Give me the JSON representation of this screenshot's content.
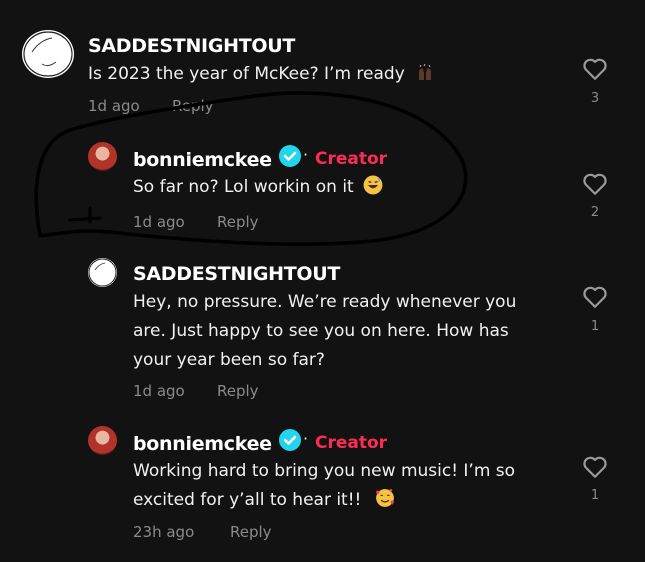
{
  "comments": [
    {
      "username": "SADDESTNIGHTOUT",
      "text": "Is 2023 the year of McKee? I’m ready",
      "emoji": "raised-hands",
      "time": "1d ago",
      "reply_label": "Reply",
      "likes": "3",
      "avatar": "sketch",
      "creator": false
    },
    {
      "username": "bonniemckee",
      "creator_label": "Creator",
      "text": "So far no? Lol workin on it",
      "emoji": "sweat-smile",
      "time": "1d ago",
      "reply_label": "Reply",
      "likes": "2",
      "avatar": "photo",
      "creator": true
    },
    {
      "username": "SADDESTNIGHTOUT",
      "text_lines": [
        "Hey, no pressure. We’re ready whenever you",
        "are. Just happy to see you on here. How has",
        "your year been so far?"
      ],
      "time": "1d ago",
      "reply_label": "Reply",
      "likes": "1",
      "avatar": "sketch",
      "creator": false
    },
    {
      "username": "bonniemckee",
      "creator_label": "Creator",
      "text_lines": [
        "Working hard to bring you new music! I’m so",
        "excited for y’all to hear it!!"
      ],
      "emoji": "smiling-hearts",
      "time": "23h ago",
      "reply_label": "Reply",
      "likes": "1",
      "avatar": "photo",
      "creator": true
    }
  ],
  "colors": {
    "background": "#121212",
    "creator": "#fe2c55",
    "verified": "#20d5ec",
    "muted": "#8a8a8a"
  }
}
